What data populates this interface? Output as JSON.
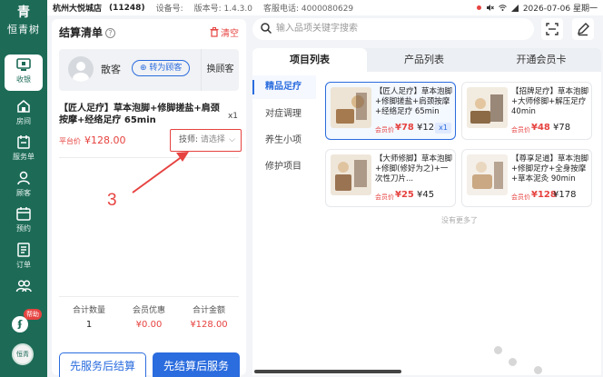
{
  "status_bar": {
    "store": "杭州大悦城店",
    "store_code": "(11248)",
    "device_label": "设备号:",
    "version": "版本号: 1.4.3.0",
    "phone": "客服电话: 4000080629",
    "datetime": "2026-07-06 星期一"
  },
  "sidebar": {
    "logo_mark": "青",
    "logo_name": "恒青树",
    "items": [
      {
        "label": "收银",
        "icon": "cashier-icon",
        "active": true
      },
      {
        "label": "房间",
        "icon": "room-icon"
      },
      {
        "label": "服务单",
        "icon": "service-order-icon"
      },
      {
        "label": "顾客",
        "icon": "customer-icon"
      },
      {
        "label": "预约",
        "icon": "calendar-icon"
      },
      {
        "label": "订单",
        "icon": "order-icon"
      },
      {
        "label": "",
        "icon": "staff-icon"
      }
    ],
    "help_badge": "帮助",
    "help_icon": "help-icon",
    "avatar_text": "恒青树"
  },
  "settlement": {
    "title": "结算清单",
    "clear_label": "清空",
    "customer_name": "散客",
    "convert_label": "转为顾客",
    "change_label": "换顾客",
    "item": {
      "title": "【匠人足疗】草本泡脚+修脚搓盐+肩颈按摩+经络足疗 65min",
      "qty": "x1",
      "price_label": "平台价",
      "price": "¥128.00",
      "tech_label": "技师:",
      "tech_placeholder": "请选择"
    },
    "summary": [
      {
        "label": "合计数量",
        "value": "1"
      },
      {
        "label": "会员优惠",
        "value": "¥0.00"
      },
      {
        "label": "合计金额",
        "value": "¥128.00"
      }
    ],
    "btn_serve_first": "先服务后结算",
    "btn_pay_first": "先结算后服务"
  },
  "annotation": {
    "number": "3",
    "color": "#e64340"
  },
  "search": {
    "placeholder": "输入品项关键字搜索"
  },
  "tabs": [
    "项目列表",
    "产品列表",
    "开通会员卡"
  ],
  "categories": [
    "精品足疗",
    "对症调理",
    "养生小项",
    "修护项目"
  ],
  "cards": [
    {
      "title": "【匠人足疗】草本泡脚+修脚搓盐+肩颈按摩+经络足疗 65min",
      "member_label": "会员价",
      "member_price": "¥78",
      "price": "¥128",
      "count": "x1",
      "selected": true
    },
    {
      "title": "【招牌足疗】草本泡脚+大师修脚+解压足疗 40min",
      "member_label": "会员价",
      "member_price": "¥48",
      "price": "¥78"
    },
    {
      "title": "【大师修脚】草本泡脚+修脚(修好为之)+一次性刀片...",
      "member_label": "会员价",
      "member_price": "¥25",
      "price": "¥45"
    },
    {
      "title": "【尊享足道】草本泡脚+修脚足疗+全身按摩+草本泥灸 90min",
      "member_label": "会员价",
      "member_price": "¥128",
      "price": "¥178"
    }
  ],
  "no_more": "没有更多了",
  "colors": {
    "brand": "#1d6b57",
    "accent": "#2b6cde",
    "danger": "#e64340"
  }
}
